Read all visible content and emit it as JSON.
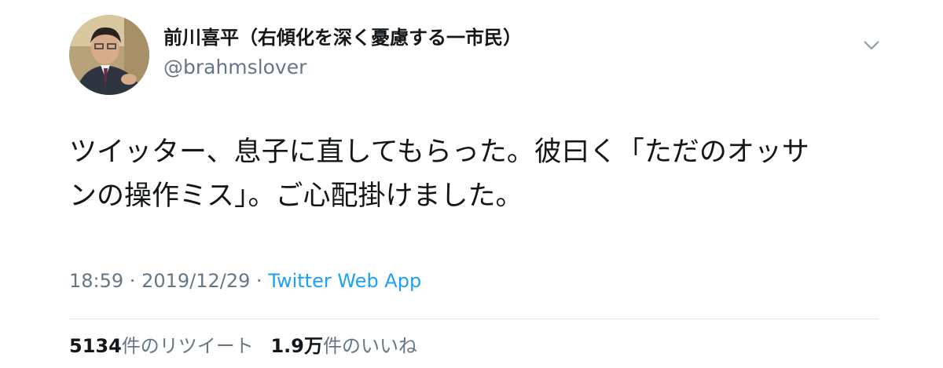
{
  "author": {
    "display_name": "前川喜平（右傾化を深く憂慮する一市民）",
    "handle": "@brahmslover"
  },
  "tweet": {
    "text_line1": "ツイッター、息子に直してもらった。彼曰く「ただのオッサ",
    "text_line2": "ンの操作ミス」。ご心配掛けました。",
    "time": "18:59",
    "date": "2019/12/29",
    "separator": " · ",
    "source": "Twitter Web App"
  },
  "stats": {
    "retweets": {
      "count": "5134",
      "label": "件のリツイート"
    },
    "likes": {
      "count": "1.9万",
      "label": "件のいいね"
    }
  },
  "icons": {
    "menu": "chevron-down-icon",
    "avatar": "profile-photo"
  },
  "colors": {
    "text": "#14171a",
    "secondary": "#657786",
    "link": "#1da1f2",
    "divider": "#e1e8ed"
  }
}
